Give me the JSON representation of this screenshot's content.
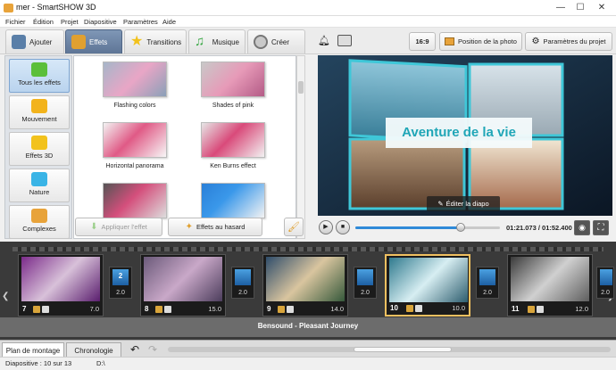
{
  "window": {
    "title": "mer - SmartSHOW 3D",
    "min": "—",
    "max": "☐",
    "close": "✕"
  },
  "menu": [
    "Fichier",
    "Édition",
    "Projet",
    "Diapositive",
    "Paramètres",
    "Aide"
  ],
  "tabs": [
    {
      "label": "Ajouter",
      "icon": "camera-icon",
      "color": "#5a7fa8"
    },
    {
      "label": "Effets",
      "icon": "palette-icon",
      "color": "#e0a030"
    },
    {
      "label": "Transitions",
      "icon": "star-icon",
      "color": "#f2c21c"
    },
    {
      "label": "Musique",
      "icon": "music-icon",
      "color": "#39a845"
    },
    {
      "label": "Créer",
      "icon": "film-reel-icon",
      "color": "#777777"
    }
  ],
  "toolbar_right": {
    "ratio": "16:9",
    "photo_position": "Position de la photo",
    "project_settings": "Paramètres du projet"
  },
  "categories": [
    {
      "label": "Tous les effets",
      "color": "#5bbf3a"
    },
    {
      "label": "Mouvement",
      "color": "#f2b31c"
    },
    {
      "label": "Effets 3D",
      "color": "#f2c21c"
    },
    {
      "label": "Nature",
      "color": "#3ab4e6"
    },
    {
      "label": "Complexes",
      "color": "#e8a33a"
    }
  ],
  "effects": [
    {
      "label": "Flashing colors",
      "bg": "linear-gradient(135deg,#a6b6c9,#e9a6c6 50%,#8aa0b8)"
    },
    {
      "label": "Shades of pink",
      "bg": "linear-gradient(135deg,#c8c8c8,#e79ab8 50%,#b35b86)"
    },
    {
      "label": "Horizontal panorama",
      "bg": "linear-gradient(135deg,#f3f3f3,#e05a86 45%,#f7f7f7)"
    },
    {
      "label": "Ken Burns effect",
      "bg": "linear-gradient(135deg,#e6e6e6,#d94a7a 45%,#f2f2f2)"
    },
    {
      "label": "",
      "bg": "linear-gradient(135deg,#555,#d44f7c 45%,#ddd)"
    },
    {
      "label": "",
      "bg": "linear-gradient(135deg,#2a7fd8,#3a98ea 40%,#f3f3f3)"
    }
  ],
  "buttons": {
    "apply": "Appliquer l'effet",
    "random": "Effets au hasard"
  },
  "preview": {
    "title": "Aventure de la vie",
    "edit": "Éditer la diapo"
  },
  "player": {
    "time": "01:21.073 / 01:52.400",
    "progress": 0.73
  },
  "slides": [
    {
      "num": "7",
      "dur": "7.0",
      "bg": "linear-gradient(135deg,#7b2b8a,#d8c1d9 50%,#5a1e6e)",
      "sel": false
    },
    {
      "num": "8",
      "dur": "15.0",
      "bg": "linear-gradient(135deg,#6b5a7a,#c9a8c8 50%,#4c3d5c)",
      "sel": false
    },
    {
      "num": "9",
      "dur": "14.0",
      "bg": "linear-gradient(135deg,#2f4d6b,#d9c59f 50%,#36593b)",
      "sel": false
    },
    {
      "num": "10",
      "dur": "10.0",
      "bg": "linear-gradient(135deg,#2f7a8e,#d7eef2 50%,#2d5d6e)",
      "sel": true
    },
    {
      "num": "11",
      "dur": "12.0",
      "bg": "linear-gradient(135deg,#3a3a3a,#d0d0d0 50%,#5e5e5e)",
      "sel": false
    }
  ],
  "transitions": [
    {
      "num": "2",
      "dur": "2.0"
    },
    {
      "num": "",
      "dur": "2.0"
    },
    {
      "num": "",
      "dur": "2.0"
    },
    {
      "num": "",
      "dur": "2.0"
    },
    {
      "num": "",
      "dur": "2.0"
    }
  ],
  "audio": {
    "track": "Bensound - Pleasant Journey"
  },
  "bottom_tabs": [
    "Plan de montage",
    "Chronologie"
  ],
  "status": {
    "slide": "Diapositive : 10 sur 13",
    "path": "D:\\"
  }
}
